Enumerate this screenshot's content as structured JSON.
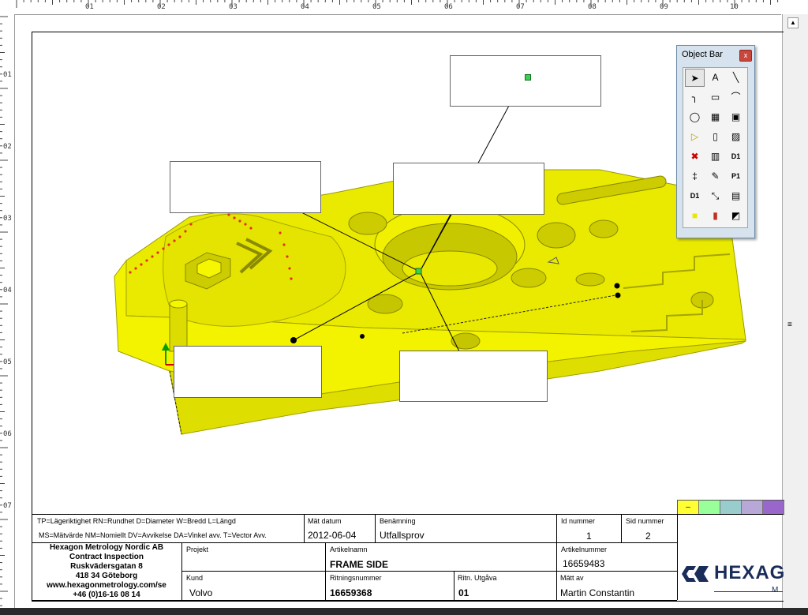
{
  "ruler": {
    "top_labels": [
      "01",
      "02",
      "03",
      "04",
      "05",
      "06",
      "07",
      "08",
      "09",
      "10"
    ],
    "left_labels": [
      "01",
      "02",
      "03",
      "04",
      "05",
      "06",
      "07"
    ]
  },
  "object_bar": {
    "title": "Object Bar",
    "close_glyph": "x",
    "tools": [
      {
        "name": "pointer-tool-icon",
        "glyph": "➤",
        "selected": true
      },
      {
        "name": "text-tool-icon",
        "glyph": "A"
      },
      {
        "name": "line-tool-icon",
        "glyph": "╲"
      },
      {
        "name": "connector-line-tool-icon",
        "glyph": "╮"
      },
      {
        "name": "rectangle-tool-icon",
        "glyph": "▭"
      },
      {
        "name": "arc-tool-icon",
        "glyph": "⌒"
      },
      {
        "name": "ellipse-tool-icon",
        "glyph": "◯"
      },
      {
        "name": "calculator-tool-icon",
        "glyph": "▦"
      },
      {
        "name": "cad-image-tool-icon",
        "glyph": "▣"
      },
      {
        "name": "play-tool-icon",
        "glyph": "▷"
      },
      {
        "name": "button-tool-icon",
        "glyph": "▯"
      },
      {
        "name": "grid-tool-icon",
        "glyph": "▨"
      },
      {
        "name": "stop-tool-icon",
        "glyph": "✖"
      },
      {
        "name": "dimension-table-tool-icon",
        "glyph": "▥"
      },
      {
        "name": "d1-tool-icon",
        "glyph": "D1"
      },
      {
        "name": "gauge-tool-icon",
        "glyph": "‡"
      },
      {
        "name": "comment-tool-icon",
        "glyph": "✎"
      },
      {
        "name": "p1-value-tool-icon",
        "glyph": "P1"
      },
      {
        "name": "d1-list-tool-icon",
        "glyph": "D1"
      },
      {
        "name": "axis-tool-icon",
        "glyph": "⤡"
      },
      {
        "name": "histogram-tool-icon",
        "glyph": "▤"
      },
      {
        "name": "yellow-box-tool-icon",
        "glyph": "■"
      },
      {
        "name": "bar-chart-tool-icon",
        "glyph": "▮"
      },
      {
        "name": "shading-tool-icon",
        "glyph": "◩"
      }
    ]
  },
  "swatches": {
    "colors": [
      "#ffff33",
      "#99ff99",
      "#99cccc",
      "#b8a8d8",
      "#9966cc"
    ],
    "first_label": "–"
  },
  "title_block": {
    "legend_line1": "TP=Lägeriktighet  RN=Rundhet  D=Diameter W=Bredd  L=Längd",
    "legend_line2": "MS=Mätvärde NM=Nomiellt  DV=Avvikelse DA=Vinkel avv. T=Vector Avv.",
    "mat_datum_label": "Mät datum",
    "mat_datum_value": "2012-06-04",
    "benamning_label": "Benämning",
    "benamning_value": "Utfallsprov",
    "id_nummer_label": "Id nummer",
    "id_nummer_value": "1",
    "sid_nummer_label": "Sid nummer",
    "sid_nummer_value": "2",
    "company_name": "Hexagon Metrology Nordic AB",
    "company_dept": "Contract Inspection",
    "company_street": "Ruskvädersgatan 8",
    "company_city": "418 34 Göteborg",
    "company_web": "www.hexagonmetrology.com/se",
    "company_phone": "+46 (0)16-16 08 14",
    "projekt_label": "Projekt",
    "artikelnamn_label": "Artikelnamn",
    "artikelnamn_value": "FRAME SIDE",
    "artikelnummer_label": "Artikelnummer",
    "artikelnummer_value": "16659483",
    "kund_label": "Kund",
    "kund_value": "Volvo",
    "ritningsnummer_label": "Ritningsnummer",
    "ritningsnummer_value": "16659368",
    "ritn_utgava_label": "Ritn. Utgåva",
    "ritn_utgava_value": "01",
    "matt_av_label": "Mätt av",
    "matt_av_value": "Martin Constantin",
    "logo_text": "HEXAG",
    "logo_sub": "M"
  }
}
